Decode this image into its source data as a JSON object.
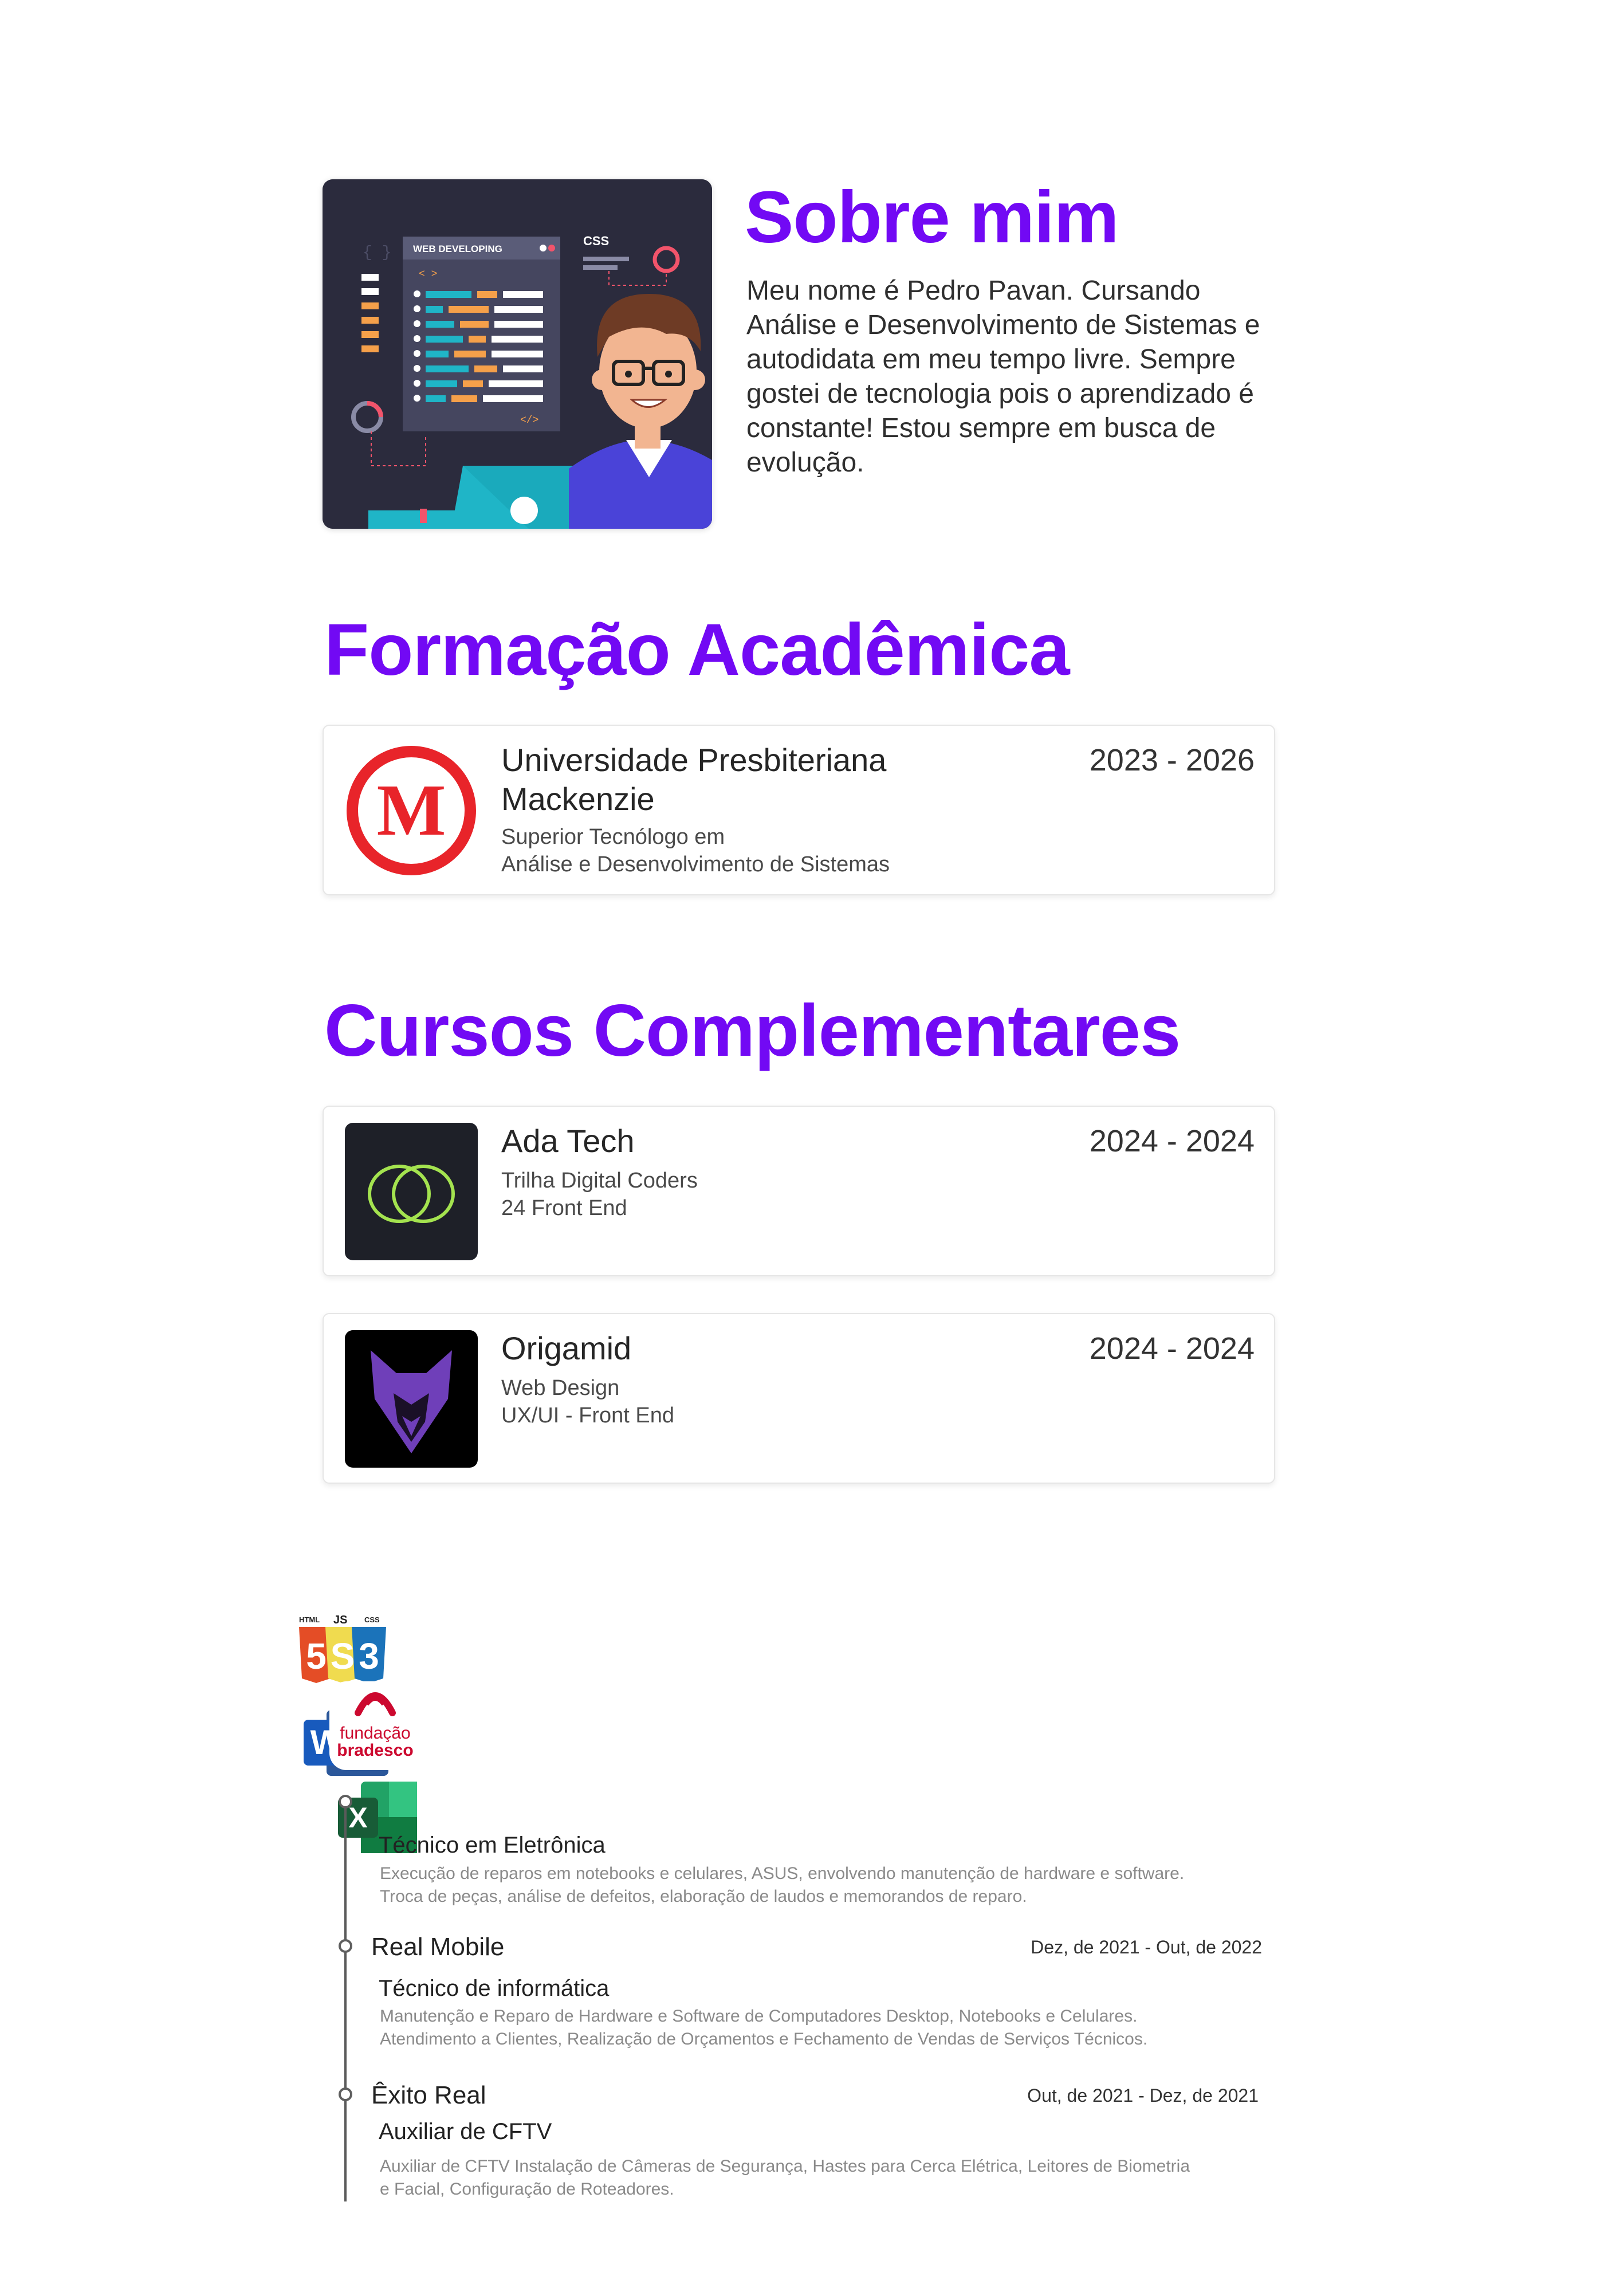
{
  "about": {
    "title": "Sobre mim",
    "text": "Meu nome é Pedro Pavan. Cursando Análise e Desenvolvimento de Sistemas e autodidata em meu tempo livre. Sempre gostei de tecnologia pois o aprendizado é constante! Estou sempre em busca de evolução.",
    "illustration": {
      "window_title": "WEB DEVELOPING",
      "css_label": "CSS",
      "code_tag": "< >",
      "code_end_tag": "</>"
    }
  },
  "formacao": {
    "title": "Formação Acadêmica",
    "items": [
      {
        "logo_letter": "M",
        "name": "Universidade Presbiteriana Mackenzie",
        "line1": "Superior Tecnólogo em",
        "line2": "Análise e Desenvolvimento de Sistemas",
        "date": "2023 - 2026"
      }
    ]
  },
  "cursos": {
    "title": "Cursos Complementares",
    "items": [
      {
        "name": "Ada Tech",
        "line1": "Trilha Digital Coders",
        "line2": "24 Front End",
        "date": "2024 - 2024"
      },
      {
        "name": "Origamid",
        "line1": "Web Design",
        "line2": "UX/UI - Front End",
        "date": "2024 - 2024"
      }
    ]
  },
  "skills": {
    "html_label": "HTML",
    "js_label": "JS",
    "css_label": "CSS",
    "word_letter": "W",
    "excel_letter": "X",
    "bradesco_line1": "fundação",
    "bradesco_line2": "bradesco"
  },
  "experience": [
    {
      "company": "",
      "role": "Técnico em Eletrônica",
      "date": "",
      "desc1": "Execução de reparos em notebooks e celulares, ASUS, envolvendo manutenção de hardware e software.",
      "desc2": "Troca de peças, análise de defeitos, elaboração de laudos e memorandos de reparo."
    },
    {
      "company": "Real Mobile",
      "role": "Técnico de informática",
      "date": "Dez, de 2021 - Out, de 2022",
      "desc1": "Manutenção e Reparo de Hardware e Software de Computadores Desktop, Notebooks e Celulares.",
      "desc2": "Atendimento a Clientes, Realização de Orçamentos e Fechamento de Vendas de Serviços Técnicos."
    },
    {
      "company": "Êxito Real",
      "role": "Auxiliar de CFTV",
      "date": "Out, de 2021 - Dez, de 2021",
      "desc1": "Auxiliar de CFTV Instalação de Câmeras de Segurança, Hastes para Cerca Elétrica, Leitores de Biometria",
      "desc2": "e Facial, Configuração de Roteadores."
    }
  ]
}
